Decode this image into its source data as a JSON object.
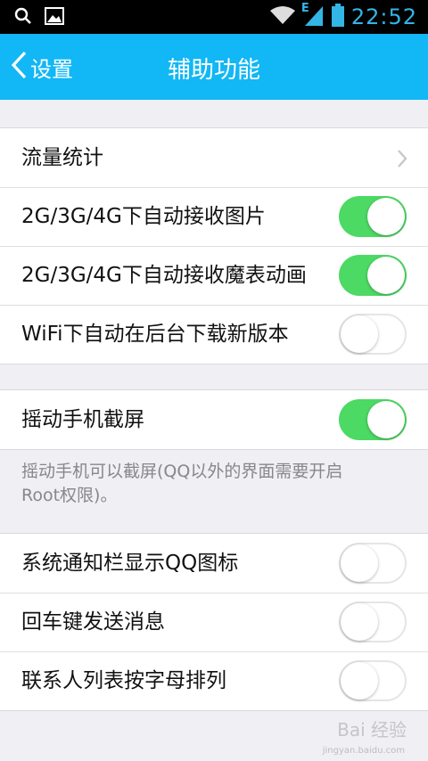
{
  "status_bar": {
    "time": "22:52",
    "network_type": "E",
    "colors": {
      "time": "#33b5e5"
    }
  },
  "nav": {
    "back_label": "设置",
    "title": "辅助功能",
    "color": "#12b7f5"
  },
  "groups": [
    {
      "rows": [
        {
          "label": "流量统计",
          "control": "chevron"
        },
        {
          "label": "2G/3G/4G下自动接收图片",
          "control": "toggle",
          "on": true
        },
        {
          "label": "2G/3G/4G下自动接收魔表动画",
          "control": "toggle",
          "on": true
        },
        {
          "label": "WiFi下自动在后台下载新版本",
          "control": "toggle",
          "on": false
        }
      ]
    },
    {
      "rows": [
        {
          "label": "摇动手机截屏",
          "control": "toggle",
          "on": true
        }
      ]
    },
    {
      "rows": [
        {
          "label": "系统通知栏显示QQ图标",
          "control": "toggle",
          "on": false
        },
        {
          "label": "回车键发送消息",
          "control": "toggle",
          "on": false
        },
        {
          "label": "联系人列表按字母排列",
          "control": "toggle",
          "on": false
        }
      ]
    }
  ],
  "shake_note": "摇动手机可以截屏(QQ以外的界面需要开启Root权限)。",
  "watermark": {
    "text": "Bai 经验",
    "sub": "jingyan.baidu.com"
  },
  "colors": {
    "toggle_on": "#4cd964",
    "background": "#efeff4"
  }
}
